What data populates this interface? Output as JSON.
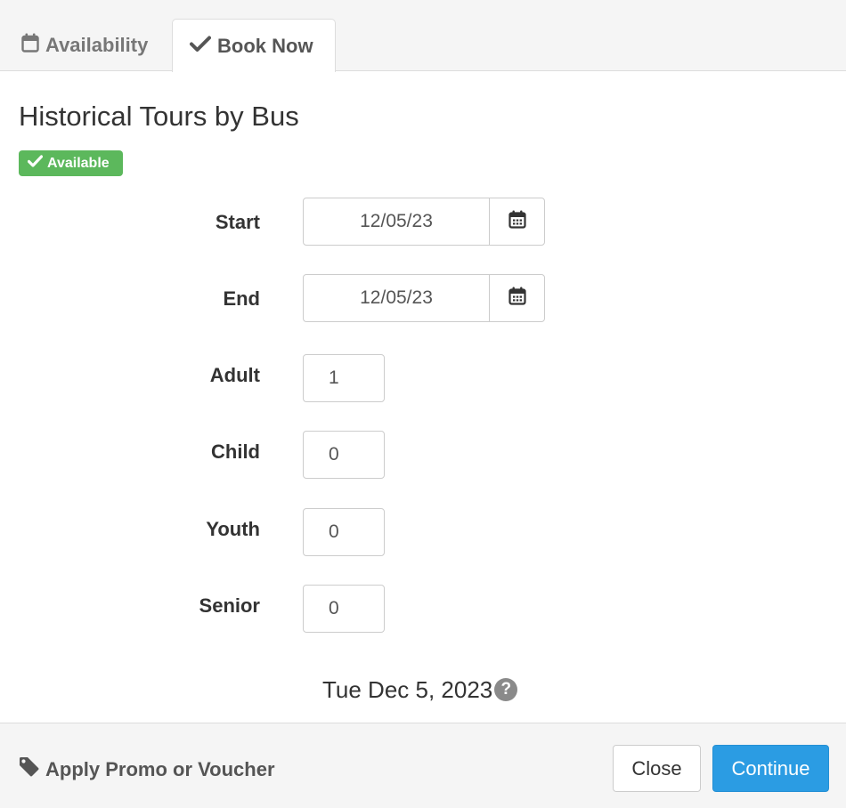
{
  "tabs": [
    {
      "label": "Availability",
      "icon": "calendar-icon",
      "active": false
    },
    {
      "label": "Book Now",
      "icon": "check-icon",
      "active": true
    }
  ],
  "tour": {
    "title": "Historical Tours by Bus",
    "status_badge": "Available",
    "status_color": "#5cb85c"
  },
  "form": {
    "start": {
      "label": "Start",
      "value": "12/05/23"
    },
    "end": {
      "label": "End",
      "value": "12/05/23"
    },
    "quantities": [
      {
        "label": "Adult",
        "value": "1"
      },
      {
        "label": "Child",
        "value": "0"
      },
      {
        "label": "Youth",
        "value": "0"
      },
      {
        "label": "Senior",
        "value": "0"
      }
    ]
  },
  "summary": {
    "date_text": "Tue Dec 5, 2023",
    "help_icon": "question-circle-icon",
    "help_glyph": "?"
  },
  "footer": {
    "promo_label": "Apply Promo or Voucher",
    "promo_icon": "tag-icon",
    "close_label": "Close",
    "continue_label": "Continue",
    "accent_color": "#2b9ce3"
  }
}
